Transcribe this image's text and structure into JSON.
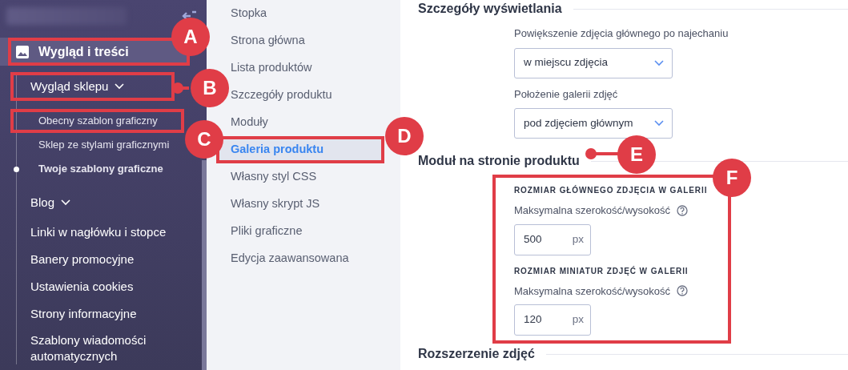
{
  "sidebar": {
    "items": [
      {
        "label": "Wygląd i treści",
        "kind": "section",
        "selected": true,
        "children": [
          {
            "label": "Wygląd sklepu",
            "kind": "group",
            "children": [
              {
                "label": "Obecny szablon graficzny",
                "selected": false
              },
              {
                "label": "Sklep ze stylami graficznymi",
                "selected": false
              },
              {
                "label": "Twoje szablony graficzne",
                "selected": true
              }
            ]
          },
          {
            "label": "Blog",
            "kind": "group"
          },
          {
            "label": "Linki w nagłówku i stopce",
            "kind": "link"
          },
          {
            "label": "Banery promocyjne",
            "kind": "link"
          },
          {
            "label": "Ustawienia cookies",
            "kind": "link"
          },
          {
            "label": "Strony informacyjne",
            "kind": "link"
          },
          {
            "label": "Szablony wiadomości automatycznych",
            "kind": "link"
          }
        ]
      }
    ]
  },
  "submenu": {
    "items": [
      {
        "label": "Stopka",
        "selected": false
      },
      {
        "label": "Strona główna",
        "selected": false
      },
      {
        "label": "Lista produktów",
        "selected": false
      },
      {
        "label": "Szczegóły produktu",
        "selected": false
      },
      {
        "label": "Moduły",
        "selected": false
      },
      {
        "label": "Galeria produktu",
        "selected": true
      },
      {
        "label": "Własny styl CSS",
        "selected": false
      },
      {
        "label": "Własny skrypt JS",
        "selected": false
      },
      {
        "label": "Pliki graficzne",
        "selected": false
      },
      {
        "label": "Edycja zaawansowana",
        "selected": false
      }
    ]
  },
  "sections": [
    {
      "title": "Szczegóły wyświetlania",
      "fields": [
        {
          "kind": "select",
          "label": "Powiększenie zdjęcia głównego po najechaniu",
          "value": "w miejscu zdjęcia"
        },
        {
          "kind": "select",
          "label": "Położenie galerii zdjęć",
          "value": "pod zdjęciem głównym"
        }
      ]
    },
    {
      "title": "Moduł na stronie produktu",
      "fields": [
        {
          "kind": "subheading",
          "text": "ROZMIAR GŁÓWNEGO ZDJĘCIA W GALERII"
        },
        {
          "kind": "number",
          "label": "Maksymalna szerokość/wysokość",
          "value": "500",
          "unit": "px"
        },
        {
          "kind": "subheading",
          "text": "ROZMIAR MINIATUR ZDJĘĆ W GALERII"
        },
        {
          "kind": "number",
          "label": "Maksymalna szerokość/wysokość",
          "value": "120",
          "unit": "px"
        }
      ]
    },
    {
      "title": "Rozszerzenie zdjęć"
    }
  ],
  "callouts": [
    {
      "letter": "A"
    },
    {
      "letter": "B"
    },
    {
      "letter": "C"
    },
    {
      "letter": "D"
    },
    {
      "letter": "E"
    },
    {
      "letter": "F"
    }
  ]
}
